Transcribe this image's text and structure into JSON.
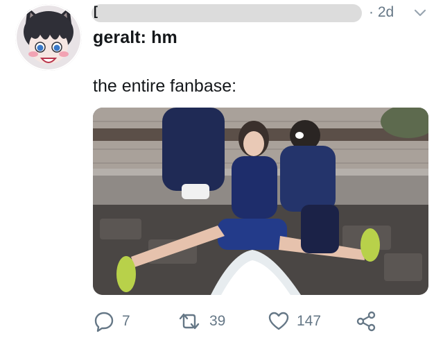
{
  "tweet": {
    "author_redacted_mark": "[",
    "timestamp": "· 2d",
    "reply_to_text": "geralt: hm",
    "body_text": "the entire fanbase:",
    "actions": {
      "reply_count": "7",
      "retweet_count": "39",
      "like_count": "147"
    }
  },
  "icons": {
    "reply": "reply-icon",
    "retweet": "retweet-icon",
    "like": "heart-icon",
    "share": "share-icon",
    "chevron": "chevron-down-icon"
  },
  "colors": {
    "text_primary": "#14171a",
    "text_secondary": "#657786",
    "redaction": "#d8d8d8"
  }
}
